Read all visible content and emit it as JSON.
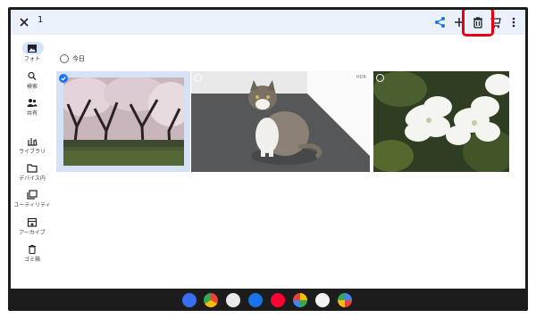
{
  "topbar": {
    "selected_count": "1",
    "icons": [
      "close-icon",
      "share-icon",
      "add-icon",
      "trash-icon",
      "tag-icon",
      "more-vert-icon"
    ]
  },
  "nav": {
    "items": [
      {
        "label": "フォト",
        "icon": "photo-icon",
        "active": true
      },
      {
        "label": "検索",
        "icon": "search-icon"
      },
      {
        "label": "共有",
        "icon": "people-icon"
      },
      {
        "label": "ライブラリ",
        "icon": "library-icon"
      },
      {
        "label": "デバイス内",
        "icon": "folder-icon"
      },
      {
        "label": "ユーティリティ",
        "icon": "utility-icon"
      },
      {
        "label": "アーカイブ",
        "icon": "archive-icon"
      },
      {
        "label": "ゴミ箱",
        "icon": "trash-icon"
      }
    ]
  },
  "content": {
    "date_label": "今日",
    "photos": [
      {
        "subject": "cherry-blossom-trees",
        "selected": true
      },
      {
        "subject": "tabby-cat",
        "selected": false,
        "badge": "HDR"
      },
      {
        "subject": "white-azalea-flowers",
        "selected": false
      }
    ]
  },
  "dock": {
    "apps": [
      "google-photos-app-icon",
      "chrome-icon",
      "camera-icon",
      "settings-icon",
      "paypay-icon",
      "pinwheel-icon",
      "assistant-icon",
      "launcher-icon"
    ]
  },
  "colors": {
    "topbar_bg": "#eaf1fb",
    "highlight": "#e60012",
    "selection_blue": "#1a73e8",
    "nav_active": "#d3e3fd"
  }
}
